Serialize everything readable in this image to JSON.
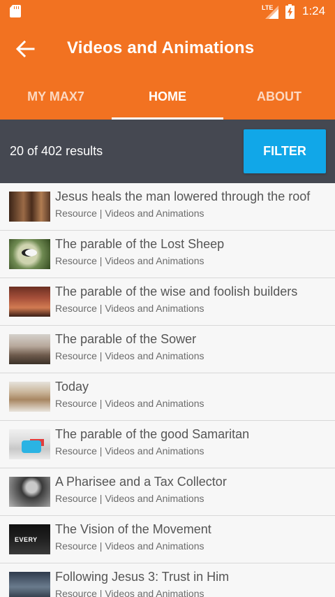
{
  "status_bar": {
    "network": "LTE",
    "time": "1:24",
    "icons": [
      "sd-card-icon",
      "signal-icon",
      "battery-charging-icon"
    ]
  },
  "app_bar": {
    "title": "Videos and Animations",
    "back_icon": "arrow-left-icon",
    "color": "#f27221"
  },
  "tabs": [
    {
      "label": "MY MAX7",
      "active": false
    },
    {
      "label": "HOME",
      "active": true
    },
    {
      "label": "ABOUT",
      "active": false
    }
  ],
  "filter_bar": {
    "results": "20 of 402 results",
    "filter_label": "FILTER",
    "filter_color": "#11a7e8"
  },
  "items": [
    {
      "title": "Jesus heals the man lowered through the roof",
      "subtitle": "Resource | Videos and Animations"
    },
    {
      "title": "The parable of the Lost Sheep",
      "subtitle": "Resource | Videos and Animations"
    },
    {
      "title": "The parable of the wise and foolish builders",
      "subtitle": "Resource | Videos and Animations"
    },
    {
      "title": "The parable of the Sower",
      "subtitle": "Resource | Videos and Animations"
    },
    {
      "title": "Today",
      "subtitle": "Resource | Videos and Animations"
    },
    {
      "title": "The parable of the good Samaritan",
      "subtitle": "Resource | Videos and Animations"
    },
    {
      "title": "A Pharisee and a Tax Collector",
      "subtitle": "Resource | Videos and Animations"
    },
    {
      "title": "The Vision of the Movement",
      "subtitle": "Resource | Videos and Animations",
      "thumb_text": "EVERY"
    },
    {
      "title": "Following Jesus 3: Trust in Him",
      "subtitle": "Resource | Videos and Animations"
    }
  ]
}
